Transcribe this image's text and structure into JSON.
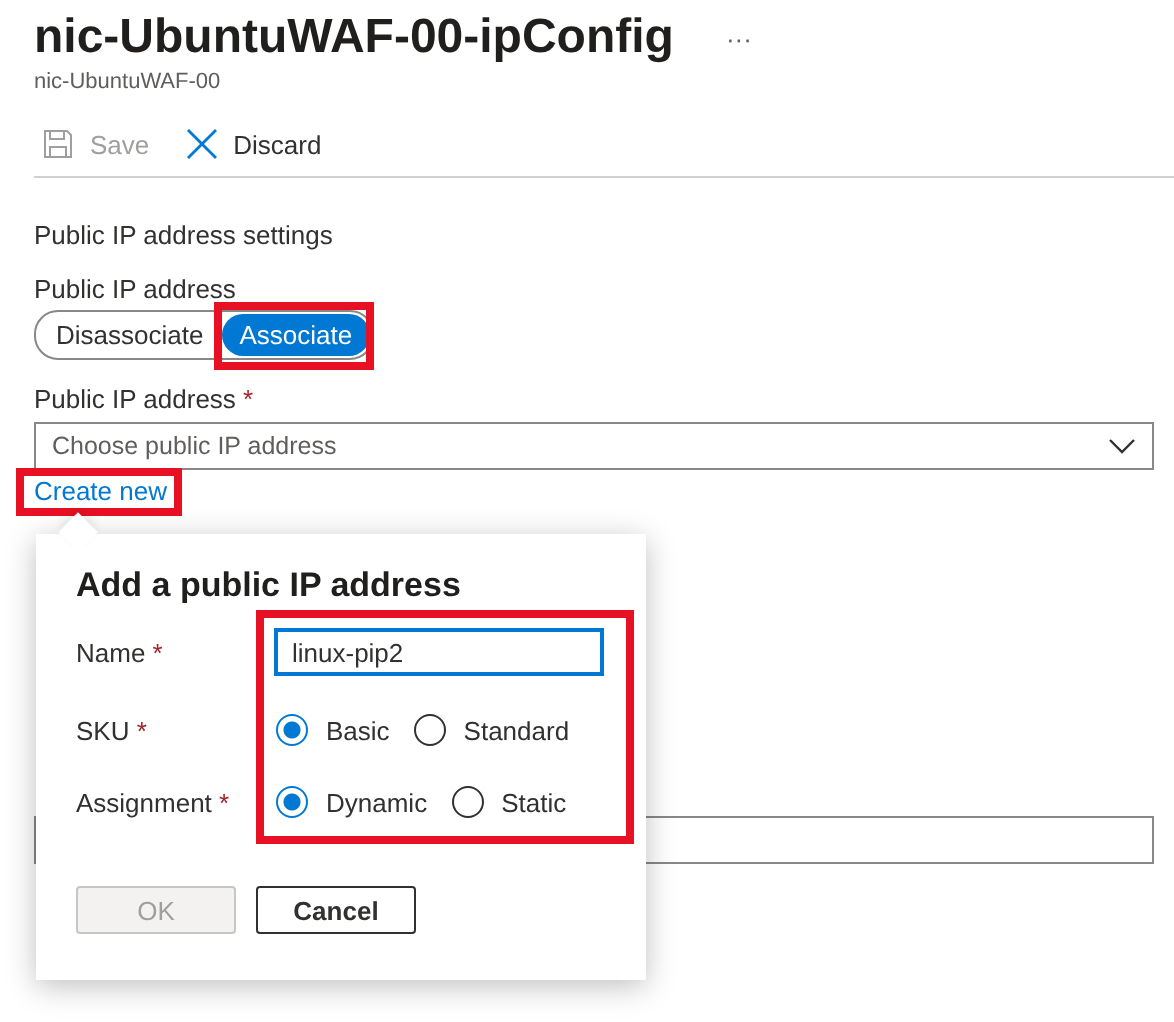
{
  "header": {
    "title": "nic-UbuntuWAF-00-ipConfig",
    "more": "···",
    "subtitle": "nic-UbuntuWAF-00"
  },
  "toolbar": [
    {
      "label": "Save",
      "kind": "save",
      "disabled": true
    },
    {
      "label": "Discard",
      "kind": "discard",
      "disabled": false
    }
  ],
  "section_title": "Public IP address settings",
  "association": {
    "label": "Public IP address",
    "highlighted": true,
    "options": [
      {
        "label": "Disassociate",
        "selected": false
      },
      {
        "label": "Associate",
        "selected": true
      }
    ]
  },
  "ip_select": {
    "label": "Public IP address",
    "required": "*",
    "placeholder": "Choose public IP address"
  },
  "create_link": {
    "label": "Create new",
    "highlighted": true
  },
  "dialog": {
    "title": "Add a public IP address",
    "highlighted": true,
    "name": {
      "label": "Name",
      "required": "*",
      "value": "linux-pip2"
    },
    "sku": {
      "label": "SKU",
      "required": "*",
      "options": [
        {
          "label": "Basic",
          "selected": true
        },
        {
          "label": "Standard",
          "selected": false
        }
      ]
    },
    "assignment": {
      "label": "Assignment",
      "required": "*",
      "options": [
        {
          "label": "Dynamic",
          "selected": true
        },
        {
          "label": "Static",
          "selected": false
        }
      ]
    },
    "buttons": [
      {
        "label": "OK",
        "disabled": true
      },
      {
        "label": "Cancel",
        "disabled": false
      }
    ]
  }
}
